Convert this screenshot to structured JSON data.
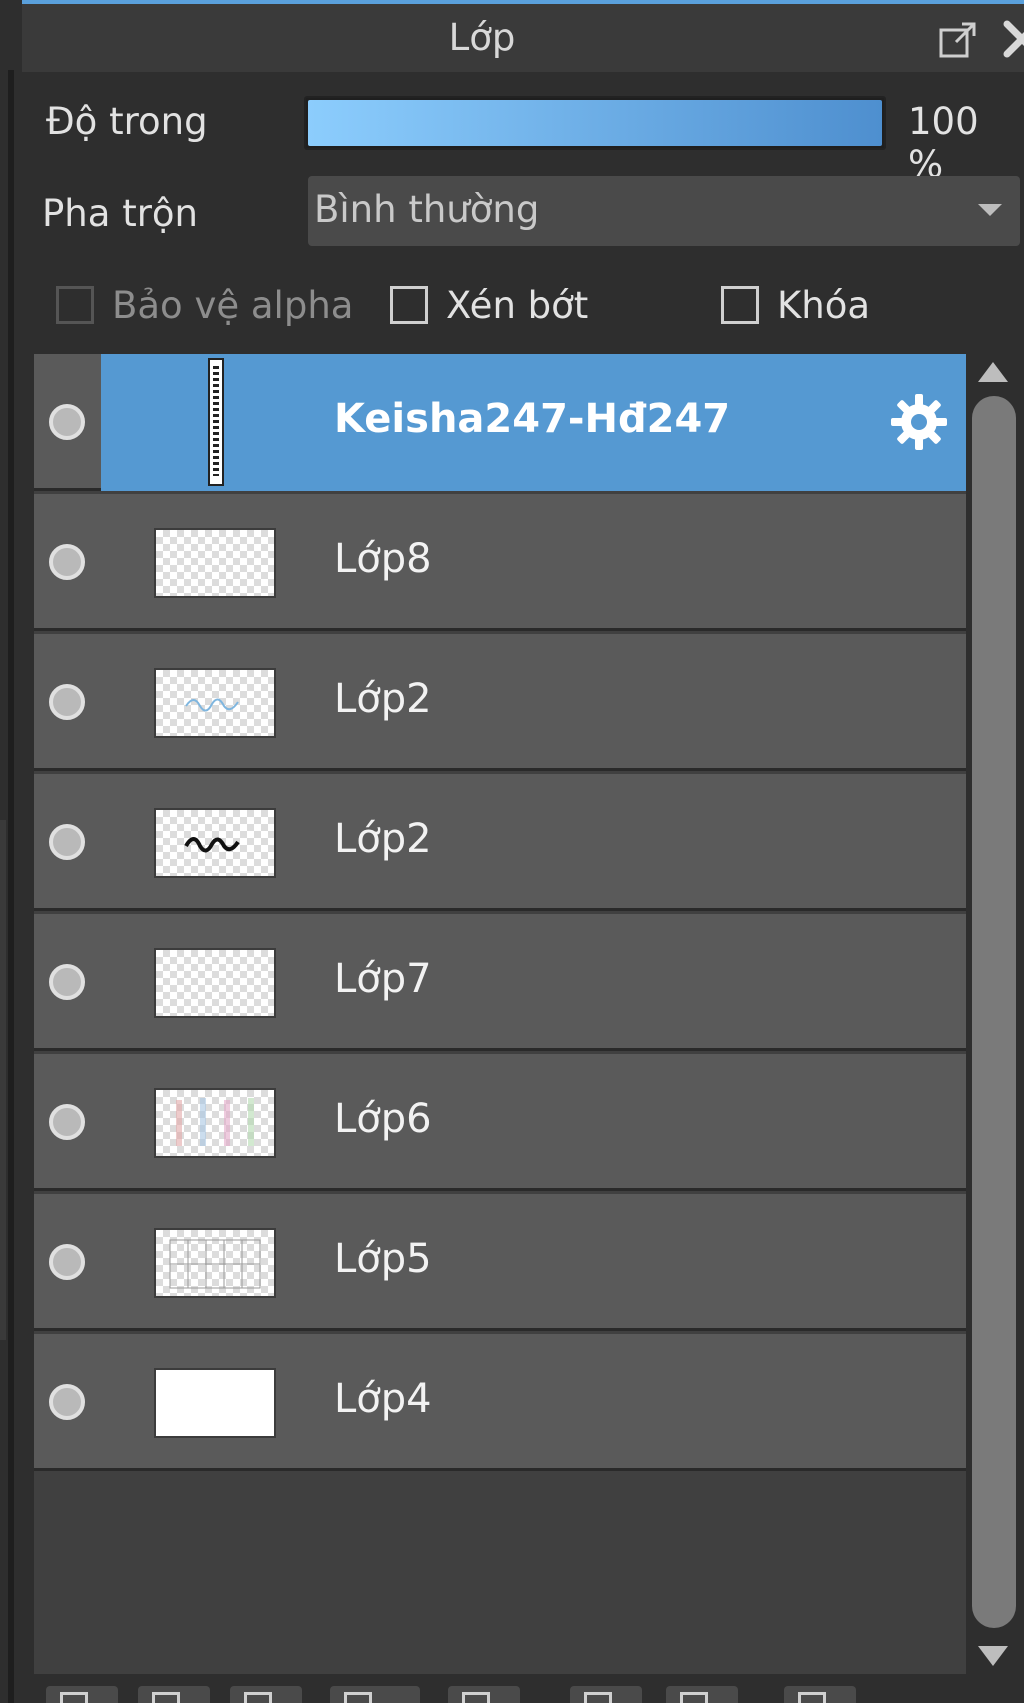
{
  "panel": {
    "title": "Lớp"
  },
  "opacity": {
    "label": "Độ trong",
    "value_text": "100 %",
    "fraction": 1.0
  },
  "blend": {
    "label": "Pha trộn",
    "value": "Bình thường"
  },
  "checkboxes": {
    "alpha_protect": "Bảo vệ alpha",
    "clip": "Xén bớt",
    "lock": "Khóa"
  },
  "layers": [
    {
      "name": "Keisha247-Hđ247",
      "selected": true
    },
    {
      "name": "Lớp8"
    },
    {
      "name": "Lớp2"
    },
    {
      "name": "Lớp2"
    },
    {
      "name": "Lớp7"
    },
    {
      "name": "Lớp6"
    },
    {
      "name": "Lớp5"
    },
    {
      "name": "Lớp4"
    }
  ],
  "colors": {
    "accent": "#5599d2",
    "row_bg": "#5a5a5a"
  }
}
